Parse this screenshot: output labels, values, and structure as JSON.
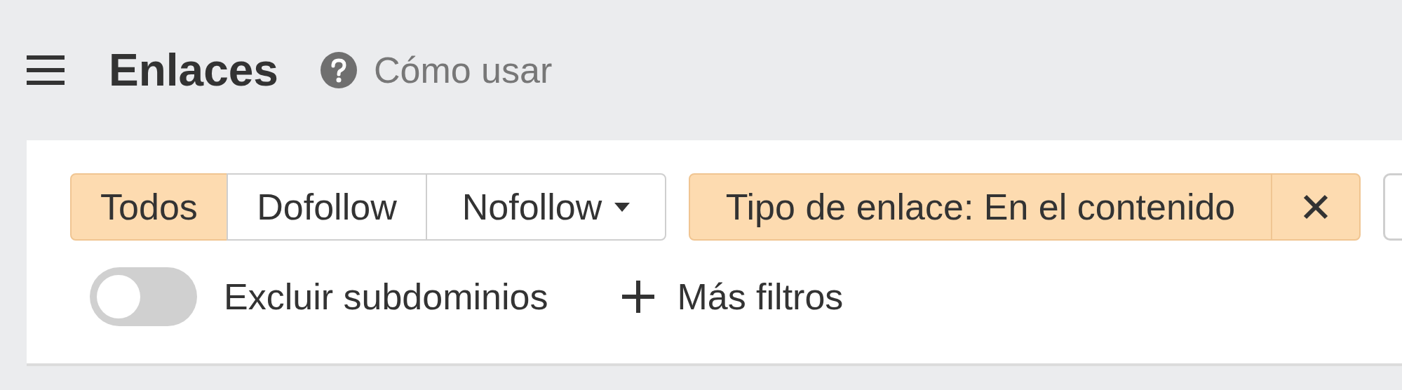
{
  "header": {
    "title": "Enlaces",
    "help_link": "Cómo usar"
  },
  "link_type_segments": [
    {
      "label": "Todos",
      "selected": true,
      "kind": "plain"
    },
    {
      "label": "Dofollow",
      "selected": false,
      "kind": "plain"
    },
    {
      "label": "Nofollow",
      "selected": false,
      "kind": "dropdown"
    }
  ],
  "active_filter": {
    "label": "Tipo de enlace: En el contenido"
  },
  "exclude_subdomains": {
    "label": "Excluir subdominios",
    "on": false
  },
  "more_filters": {
    "label": "Más filtros"
  }
}
